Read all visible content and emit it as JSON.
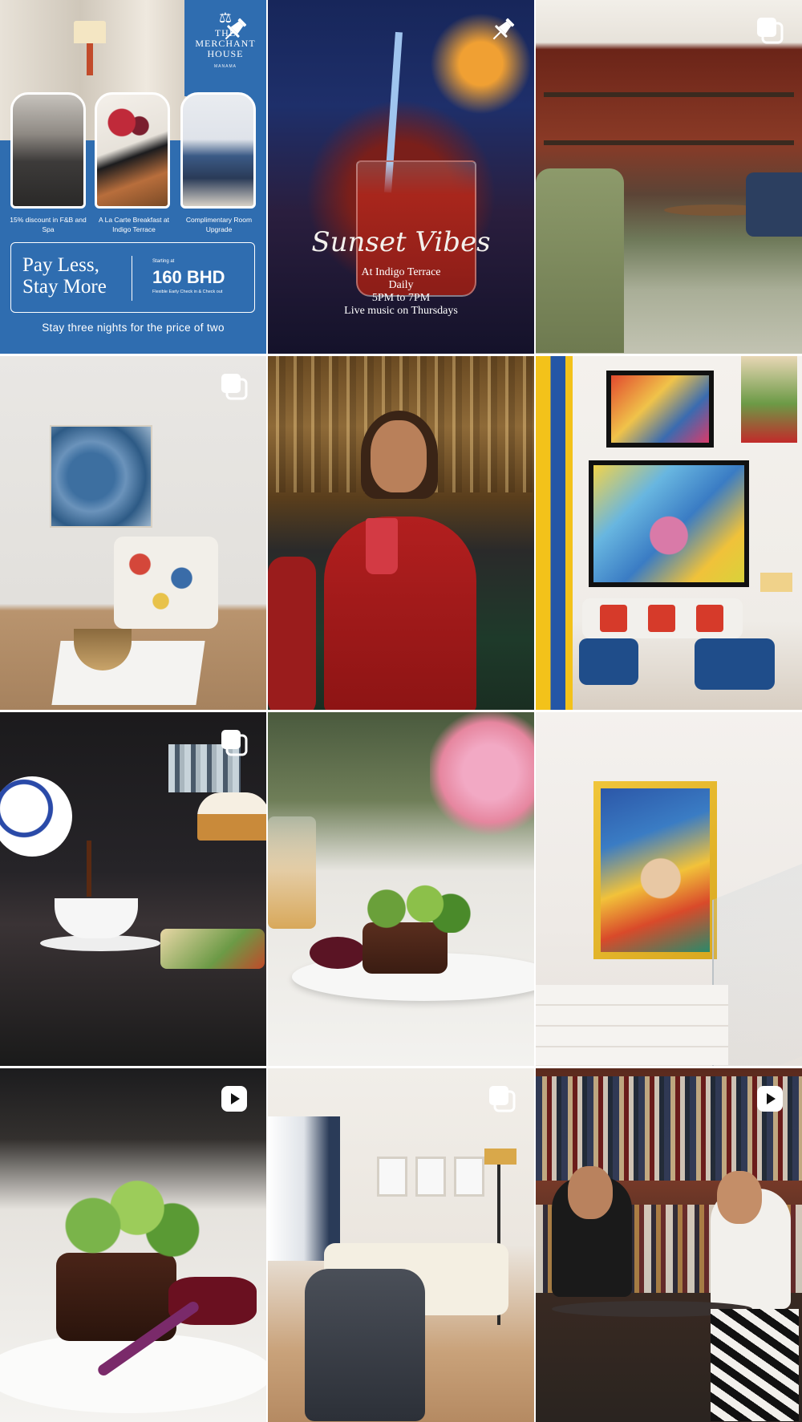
{
  "feed": {
    "posts": [
      {
        "badge": "pinned",
        "logo": {
          "line1": "THE",
          "line2": "MERCHANT",
          "line3": "HOUSE",
          "sub": "MANAMA"
        },
        "captions": [
          "15% discount in F&B and Spa",
          "A La Carte Breakfast at Indigo Terrace",
          "Complimentary Room Upgrade"
        ],
        "headline_1": "Pay Less,",
        "headline_2": "Stay More",
        "price_prefix": "Starting at",
        "price": "160 BHD",
        "price_note": "Flexible Early Check in & Check out",
        "tagline": "Stay three nights for the price of two"
      },
      {
        "badge": "pinned",
        "title": "Sunset Vibes",
        "lines": [
          "At Indigo Terrace",
          "Daily",
          "5PM to 7PM",
          "Live music on Thursdays"
        ]
      },
      {
        "badge": "carousel"
      },
      {
        "badge": "carousel"
      },
      {
        "badge": "none"
      },
      {
        "badge": "none"
      },
      {
        "badge": "carousel"
      },
      {
        "badge": "none"
      },
      {
        "badge": "none"
      },
      {
        "badge": "reel"
      },
      {
        "badge": "carousel"
      },
      {
        "badge": "reel"
      }
    ]
  },
  "icons": {
    "pinned": "pin-icon",
    "carousel": "carousel-icon",
    "reel": "reel-icon"
  },
  "colors": {
    "promo_blue": "#2f6db0",
    "badge_white": "#ffffff"
  }
}
